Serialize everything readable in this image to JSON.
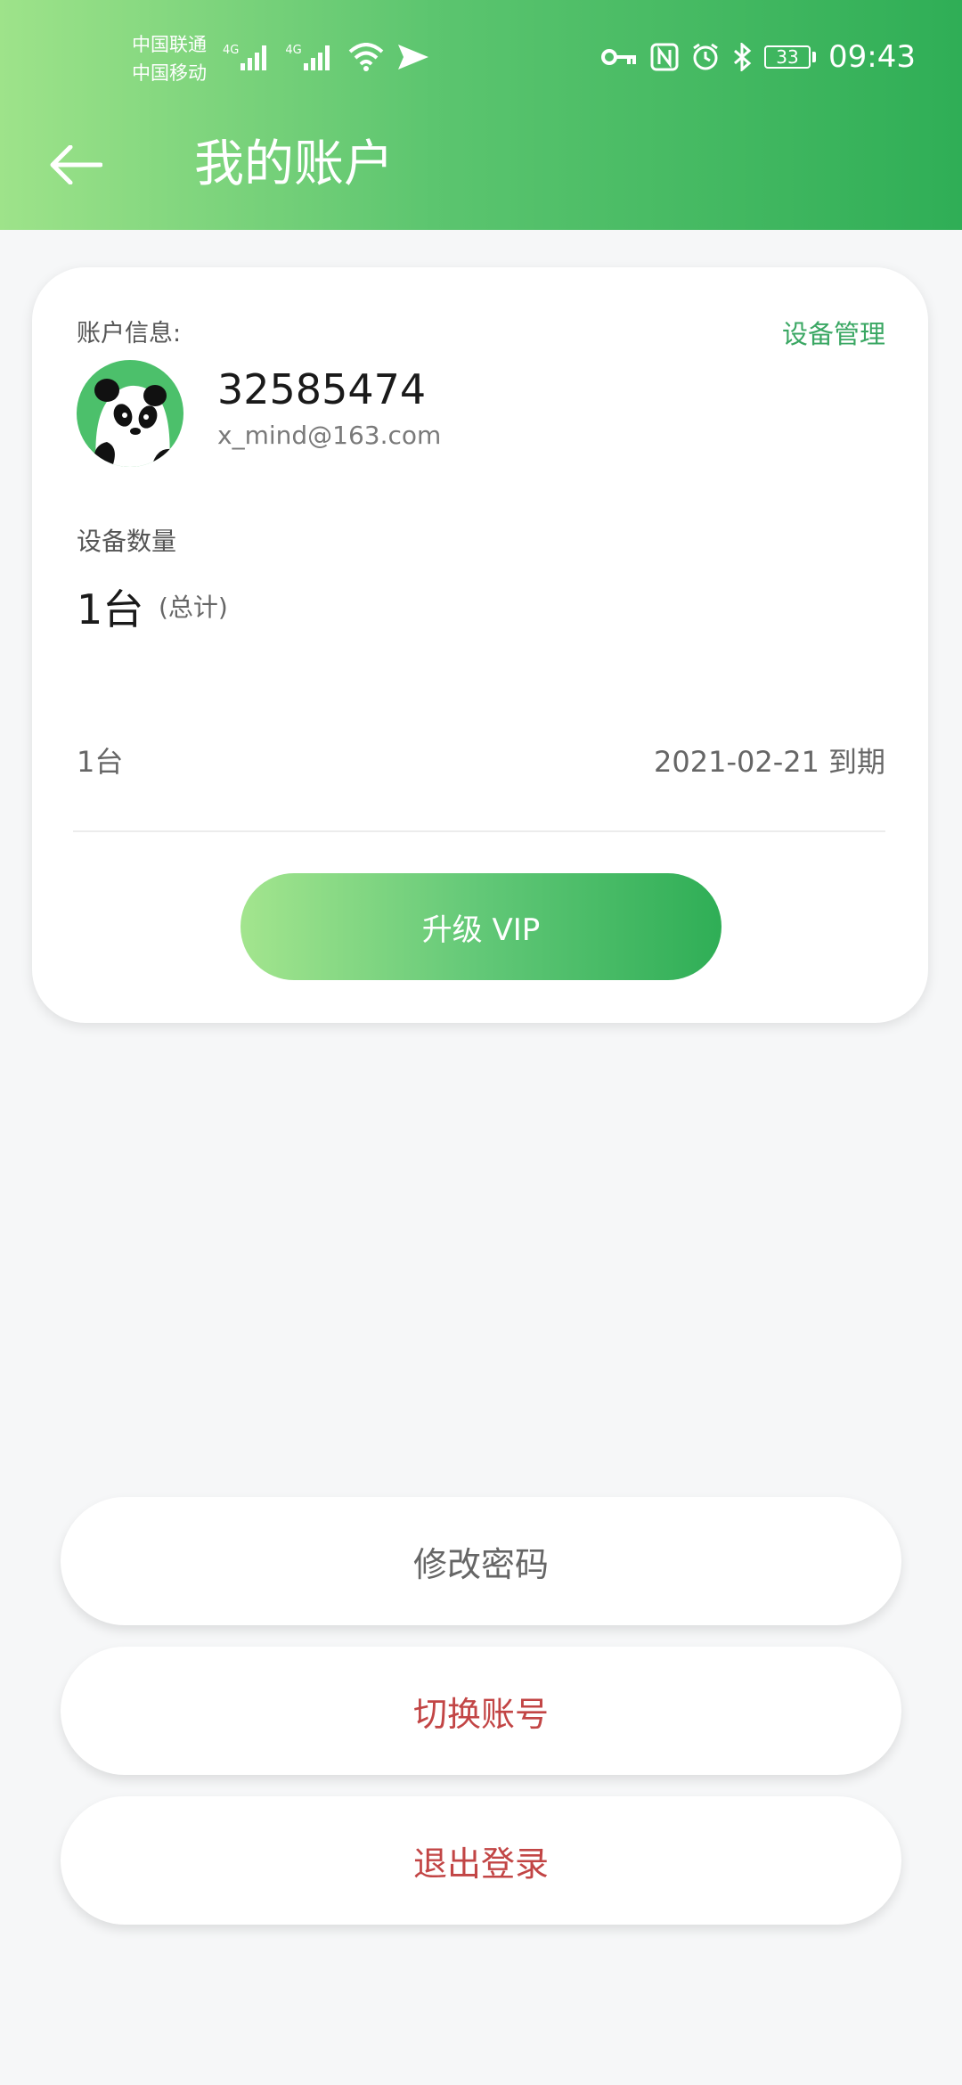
{
  "status_bar": {
    "carrier_1": "中国联通",
    "carrier_2": "中国移动",
    "network_1": "4G",
    "network_2": "4G",
    "battery": "33",
    "time": "09:43",
    "icons": [
      "signal-icon",
      "wifi-icon",
      "send-icon",
      "key-icon",
      "nfc-icon",
      "alarm-icon",
      "bluetooth-icon",
      "battery-icon"
    ]
  },
  "header": {
    "title": "我的账户",
    "back_icon": "arrow-left-icon"
  },
  "account_card": {
    "section_label": "账户信息:",
    "device_manage_link": "设备管理",
    "user_id": "32585474",
    "email": "x_mind@163.com",
    "device_count_label": "设备数量",
    "device_count": "1台",
    "device_count_note": "(总计)",
    "plan_quantity": "1台",
    "expiry_date": "2021-02-21",
    "expiry_suffix": "到期",
    "upgrade_button": "升级 VIP"
  },
  "actions": {
    "change_password": "修改密码",
    "switch_account": "切换账号",
    "logout": "退出登录"
  },
  "colors": {
    "accent_green": "#2fae56",
    "light_green": "#9ee38a",
    "danger_red": "#c24545"
  }
}
